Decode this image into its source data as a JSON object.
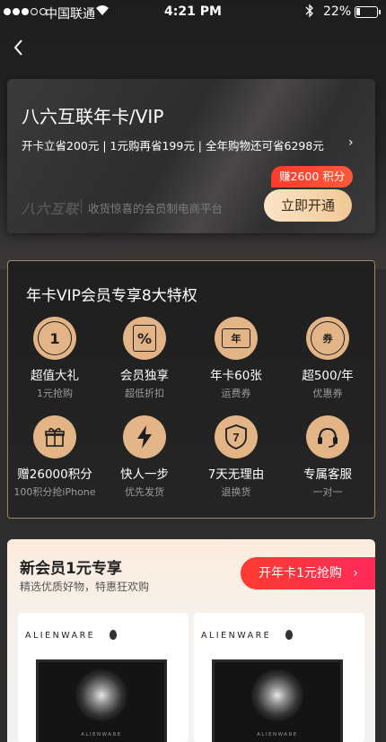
{
  "status_bar": {
    "carrier": "中国联通",
    "time": "4:21 PM",
    "battery": "22%"
  },
  "vip_card": {
    "title": "八六互联年卡/VIP",
    "benefits": "开卡立省200元 | 1元购再省199元 | 全年购物还可省6298元",
    "brand_logo": "八六互联",
    "brand_tagline": "收货惊喜的会员制电商平台",
    "earn_badge": "赚2600 积分",
    "open_button": "立即开通"
  },
  "privileges": {
    "title": "年卡VIP会员专享8大特权",
    "items": [
      {
        "icon_text": "1",
        "icon": "number-one-icon",
        "name": "超值大礼",
        "sub": "1元抢购"
      },
      {
        "icon_text": "%",
        "icon": "discount-tag-icon",
        "name": "会员独享",
        "sub": "超低折扣"
      },
      {
        "icon_text": "年",
        "icon": "ticket-icon",
        "name": "年卡60张",
        "sub": "运费券"
      },
      {
        "icon_text": "券",
        "icon": "coupon-icon",
        "name": "超500/年",
        "sub": "优惠券"
      },
      {
        "icon_text": "🎁",
        "icon": "gift-icon",
        "name": "赠26000积分",
        "sub": "100积分抢iPhone"
      },
      {
        "icon_text": "⚡",
        "icon": "lightning-icon",
        "name": "快人一步",
        "sub": "优先发货"
      },
      {
        "icon_text": "7",
        "icon": "shield-seven-icon",
        "name": "7天无理由",
        "sub": "退换货"
      },
      {
        "icon_text": "🎧",
        "icon": "headset-icon",
        "name": "专属客服",
        "sub": "一对一"
      }
    ]
  },
  "new_member": {
    "title": "新会员1元专享",
    "subtitle": "精选优质好物，特惠狂欢购",
    "button": "开年卡1元抢购",
    "products": [
      {
        "brand": "ALIENWARE",
        "screen_brand": "ALIENWARE"
      },
      {
        "brand": "ALIENWARE",
        "screen_brand": "ALIENWARE"
      }
    ]
  }
}
